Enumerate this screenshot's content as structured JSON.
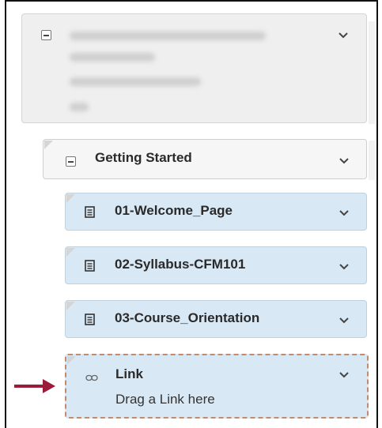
{
  "course": {
    "name": "",
    "code": "",
    "ends": "",
    "term": ""
  },
  "module": {
    "title": "Getting Started"
  },
  "items": [
    {
      "title": "01-Welcome_Page",
      "icon": "document-icon"
    },
    {
      "title": "02-Syllabus-CFM101",
      "icon": "document-icon"
    },
    {
      "title": "03-Course_Orientation",
      "icon": "document-icon"
    }
  ],
  "link_item": {
    "title": "Link",
    "hint": "Drag a Link here",
    "icon": "link-icon"
  },
  "colors": {
    "course_bg": "#efefef",
    "module_bg": "#f6f6f6",
    "item_bg": "#d9e8f5",
    "arrow": "#9b1b3b",
    "drop_border": "#c58a6a"
  }
}
